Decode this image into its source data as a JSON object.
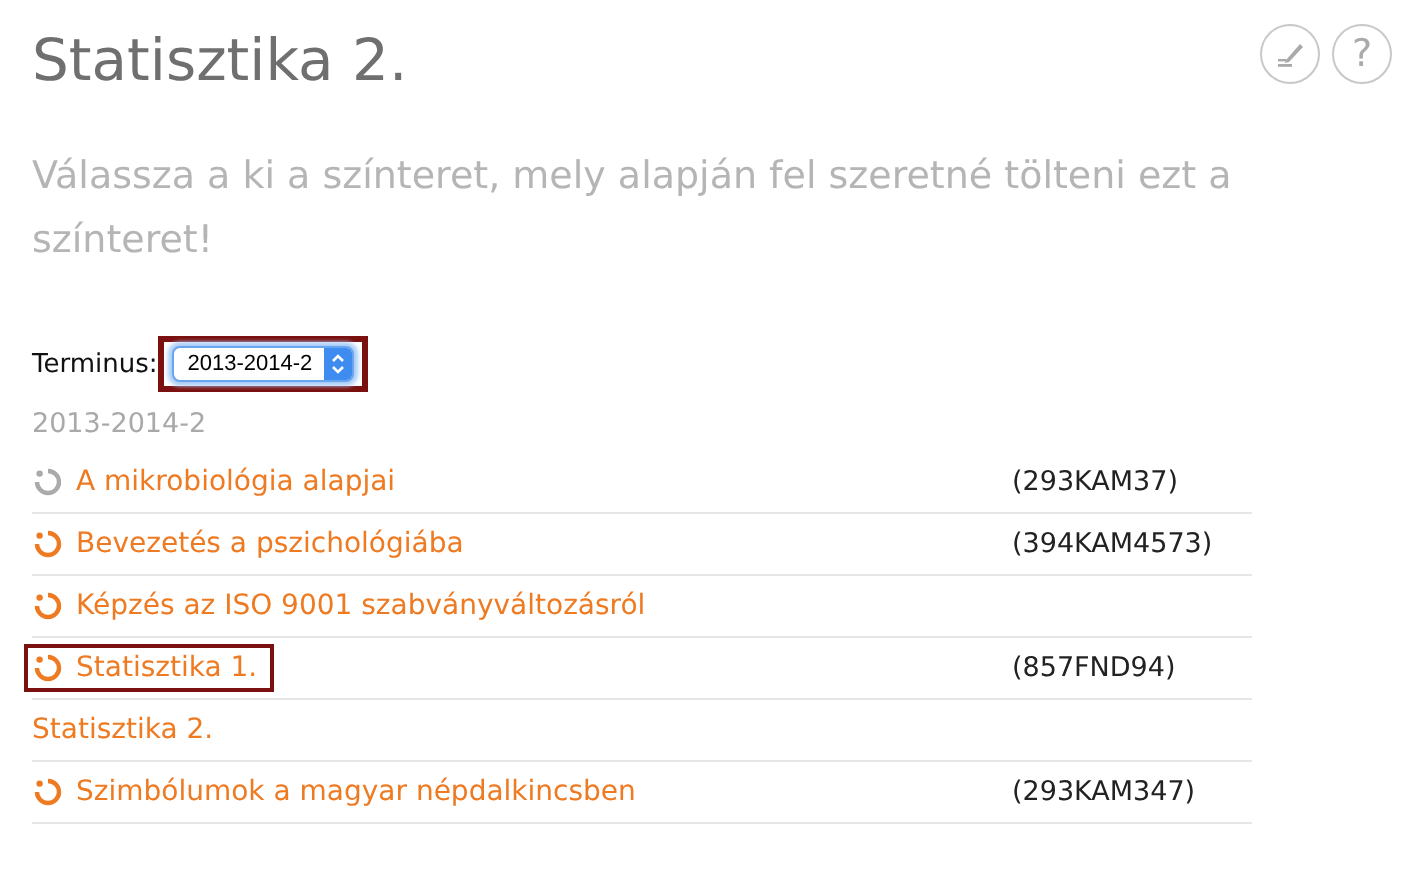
{
  "title": "Statisztika 2.",
  "help_button": "?",
  "subtitle": "Válassza a ki a színteret, mely alapján fel szeretné tölteni ezt a színteret!",
  "term": {
    "label": "Terminus:",
    "value": "2013-2014-2",
    "highlighted": true
  },
  "group_heading": "2013-2014-2",
  "courses": [
    {
      "name": "A mikrobiológia alapjai",
      "code": "(293KAM37)",
      "color": "#aaaaaa",
      "highlighted": false
    },
    {
      "name": "Bevezetés a pszichológiába",
      "code": "(394KAM4573)",
      "color": "#ee7a22",
      "highlighted": false
    },
    {
      "name": "Képzés az ISO 9001 szabványváltozásról",
      "color": "#ee7a22",
      "highlighted": false
    },
    {
      "name": "Statisztika 1.",
      "code": "(857FND94)",
      "color": "#ee7a22",
      "highlighted": true
    },
    {
      "name": "Statisztika 2.",
      "highlighted": false
    },
    {
      "name": "Szimbólumok a magyar népdalkincsben",
      "code": "(293KAM347)",
      "color": "#ee7a22",
      "highlighted": false
    }
  ]
}
